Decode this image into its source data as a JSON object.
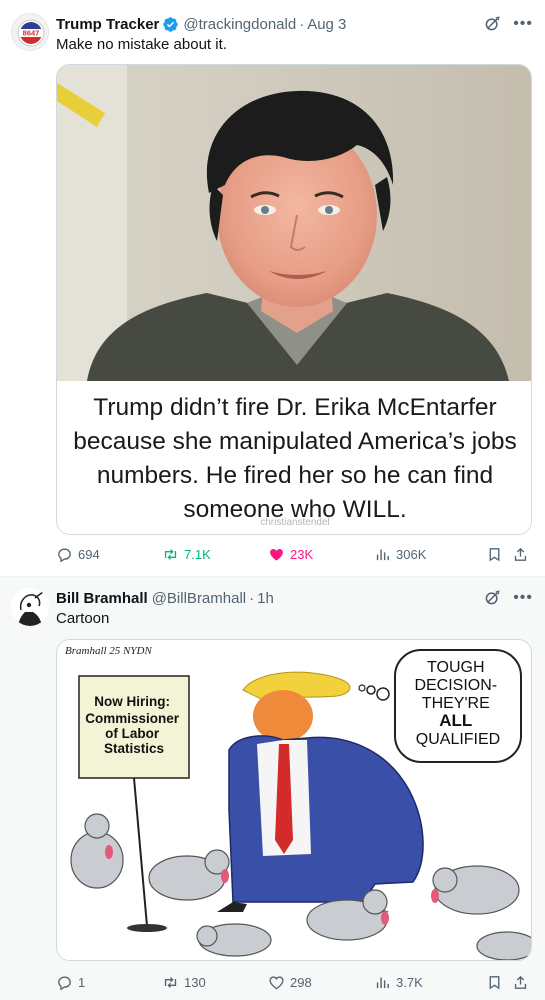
{
  "tweets": [
    {
      "author": "Trump Tracker",
      "handle": "@trackingdonald",
      "time": "Aug 3",
      "avatar_text": "8647",
      "text": "Make no mistake about it.",
      "image_caption": "Trump didn’t fire Dr. Erika McEntarfer because she manipulated America’s jobs numbers. He fired her so he can find someone who WILL.",
      "watermark": "christianstendel",
      "replies": "694",
      "reposts": "7.1K",
      "likes": "23K",
      "views": "306K"
    },
    {
      "author": "Bill Bramhall",
      "handle": "@BillBramhall",
      "time": "1h",
      "text": "Cartoon",
      "cartoon": {
        "signature": "Bramhall 25 NYDN",
        "sign_lines": [
          "Now Hiring:",
          "Commissioner",
          "of Labor",
          "Statistics"
        ],
        "bubble_lines": [
          "TOUGH",
          "DECISION-",
          "THEY'RE",
          "ALL",
          "QUALIFIED"
        ]
      },
      "replies": "1",
      "reposts": "130",
      "likes": "298",
      "views": "3.7K"
    }
  ],
  "colors": {
    "text": "#0f1419",
    "secondary": "#536471",
    "verified": "#1d9bf0",
    "repost_active": "#00ba7c",
    "like_active": "#f91880",
    "border": "#cfd9de"
  },
  "icons": [
    "verified-badge-icon",
    "grok-icon",
    "more-icon",
    "reply-icon",
    "repost-icon",
    "like-icon",
    "views-icon",
    "bookmark-icon",
    "share-icon"
  ]
}
